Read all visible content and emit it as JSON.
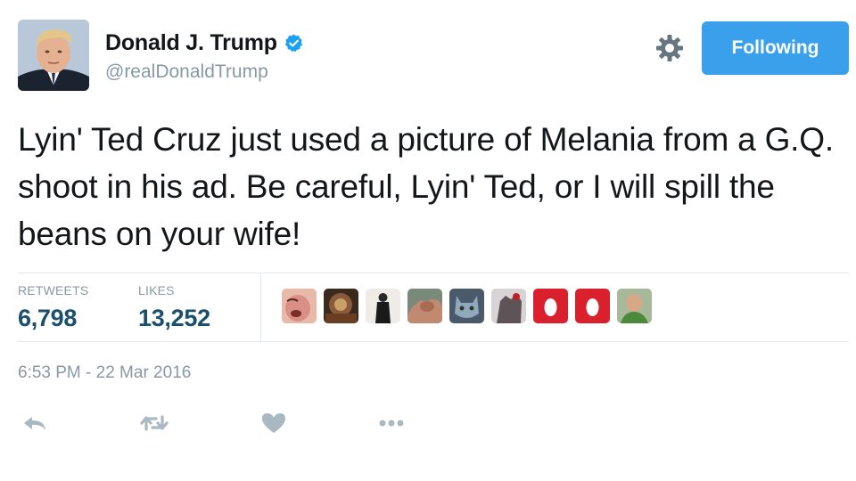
{
  "user": {
    "display_name": "Donald J. Trump",
    "handle": "@realDonaldTrump",
    "verified": true
  },
  "follow_button": {
    "label": "Following",
    "color": "#3aa0ec"
  },
  "tweet": {
    "text": "Lyin' Ted Cruz just used a picture of Melania from a G.Q. shoot in his ad. Be careful, Lyin' Ted, or I will spill the beans on your wife!"
  },
  "stats": {
    "retweets_label": "RETWEETS",
    "retweets_value": "6,798",
    "likes_label": "LIKES",
    "likes_value": "13,252"
  },
  "likers": [
    {
      "name": "liker-avatar-1",
      "color": "#d98f86"
    },
    {
      "name": "liker-avatar-2",
      "color": "#8a5a3a"
    },
    {
      "name": "liker-avatar-3",
      "color": "#e8e4df"
    },
    {
      "name": "liker-avatar-4",
      "color": "#c08a70"
    },
    {
      "name": "liker-avatar-5",
      "color": "#6f8fa8"
    },
    {
      "name": "liker-avatar-6",
      "color": "#7a6e72"
    },
    {
      "name": "liker-avatar-7",
      "color": "#d9202c"
    },
    {
      "name": "liker-avatar-8",
      "color": "#d9202c"
    },
    {
      "name": "liker-avatar-9",
      "color": "#6f8a5e"
    }
  ],
  "timestamp": "6:53 PM - 22 Mar 2016",
  "actions": [
    "reply-icon",
    "retweet-icon",
    "like-icon",
    "more-icon"
  ],
  "colors": {
    "link_blue": "#1da1f2",
    "stat_value": "#1a4f6e",
    "muted": "#8899a6",
    "action_gray": "#aab8c2"
  }
}
